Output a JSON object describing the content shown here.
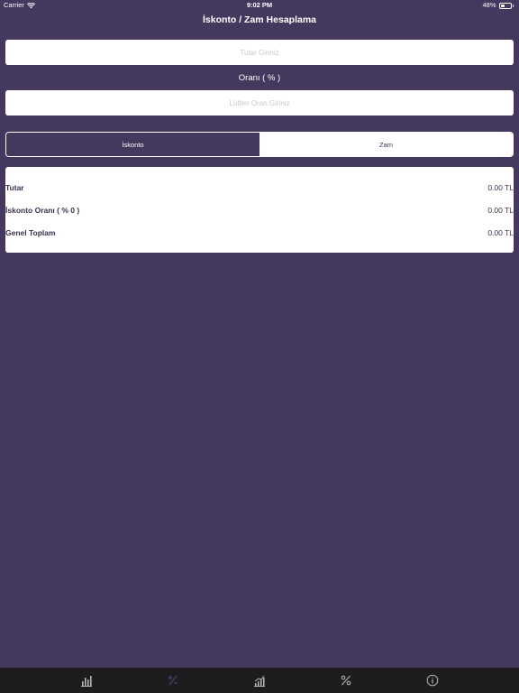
{
  "status_bar": {
    "carrier": "Carrier",
    "time": "9:02 PM",
    "battery": "48%",
    "battery_level": 0.48
  },
  "nav": {
    "title": "İskonto / Zam Hesaplama"
  },
  "form": {
    "amount_placeholder": "Tutar Giriniz",
    "rate_label": "Oranı ( % )",
    "rate_placeholder": "Lütfen Oran Giriniz"
  },
  "segmented": {
    "options": [
      "İskonto",
      "Zam"
    ],
    "selected": "İskonto"
  },
  "results": {
    "rows": [
      {
        "label": "Tutar",
        "value": "0.00 TL"
      },
      {
        "label": "İskonto Oranı ( % 0 )",
        "value": "0.00 TL"
      },
      {
        "label": "Genel Toplam",
        "value": "0.00 TL"
      }
    ]
  },
  "colors": {
    "background": "#45385e",
    "tab_bar": "#1f1c20",
    "tab_icon": "#b5b5b5",
    "tab_icon_active": "#4d4475"
  },
  "tab_bar": {
    "items": [
      {
        "icon": "bar-chart-icon",
        "active": false
      },
      {
        "icon": "plus-minus-icon",
        "active": true
      },
      {
        "icon": "growth-chart-icon",
        "active": false
      },
      {
        "icon": "percent-icon",
        "active": false
      },
      {
        "icon": "info-icon",
        "active": false
      }
    ]
  }
}
